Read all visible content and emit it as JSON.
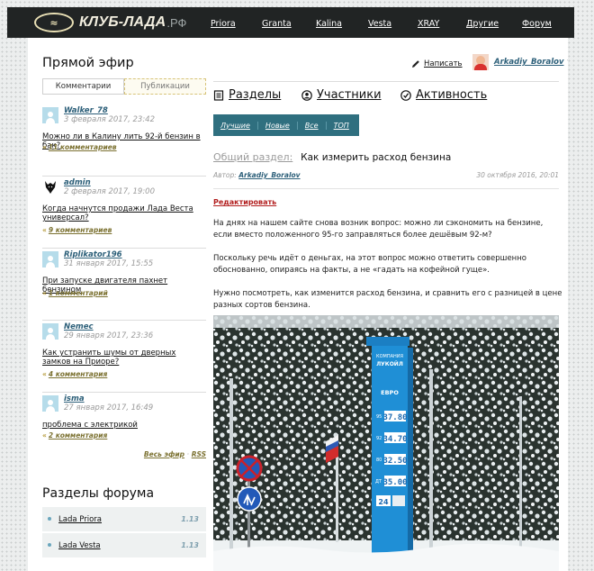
{
  "header": {
    "logo_text": "КЛУБ-ЛАДА",
    "logo_suffix": ".РФ",
    "nav": [
      "Priora",
      "Granta",
      "Kalina",
      "Vesta",
      "XRAY",
      "Другие",
      "Форум"
    ]
  },
  "live": {
    "title": "Прямой эфир",
    "tabs": [
      "Комментарии",
      "Публикации"
    ],
    "items": [
      {
        "user": "Walker_78",
        "date": "3 февраля 2017, 23:42",
        "text": "Можно ли в Калину лить 92-й бензин в бак?",
        "comments": "11 комментариев",
        "avatar": "person"
      },
      {
        "user": "admin",
        "date": "2 февраля 2017, 19:00",
        "text": "Когда начнутся продажи Лада Веста универсал?",
        "comments": "9 комментариев",
        "avatar": "wolf"
      },
      {
        "user": "Riplikator196",
        "date": "31 января 2017, 15:55",
        "text": "При запуске двигателя пахнет бензином",
        "comments": "1 комментарий",
        "avatar": "person"
      },
      {
        "user": "Nemec",
        "date": "29 января 2017, 23:36",
        "text": "Как устранить шумы от дверных замков на Приоре?",
        "comments": "4 комментария",
        "avatar": "person"
      },
      {
        "user": "isma",
        "date": "27 января 2017, 16:49",
        "text": "проблема с электрикой",
        "comments": "2 комментария",
        "avatar": "person"
      }
    ],
    "footer_all": "Весь эфир",
    "footer_sep": "·",
    "footer_rss": "RSS"
  },
  "forum_sections": {
    "title": "Разделы форума",
    "items": [
      {
        "label": "Lada Priora",
        "count": "1.13"
      },
      {
        "label": "Lada Vesta",
        "count": "1.13"
      }
    ]
  },
  "userbar": {
    "write_label": "Написать",
    "username": "Arkadiy_Boralov",
    "caret": "▼"
  },
  "sections": {
    "items": [
      "Разделы",
      "Участники",
      "Активность"
    ]
  },
  "sort": {
    "items": [
      "Лучшие",
      "Новые",
      "Все",
      "ТОП"
    ]
  },
  "post": {
    "section": "Общий раздел:",
    "title": "Как измерить расход бензина",
    "author_prefix": "Автор:",
    "author": "Arkadiy_Boralov",
    "date": "30 октября 2016, 20:01",
    "edit_label": "Редактировать",
    "paragraphs": [
      "На днях на нашем сайте снова возник вопрос: можно ли сэкономить на бензине, если вместо положенного 95-го заправляться более дешёвым 92-м?",
      "Поскольку речь идёт о деньгах, на этот вопрос можно ответить совершенно обоснованно, опираясь на факты, а не «гадать на кофейной гуще».",
      "Нужно посмотреть, как изменится расход бензина, и сравнить его с разницей в цене разных сортов бензина."
    ]
  },
  "photo": {
    "station_name_1": "КОМПАНИЯ",
    "station_name_2": "ЛУКОЙЛ",
    "station_brand": "ЕВРО",
    "fuel_codes": [
      "95",
      "92",
      "80",
      "ДТ"
    ],
    "prices": [
      "37.80",
      "34.70",
      "32.50",
      "35.00"
    ],
    "sign_24": "24"
  }
}
